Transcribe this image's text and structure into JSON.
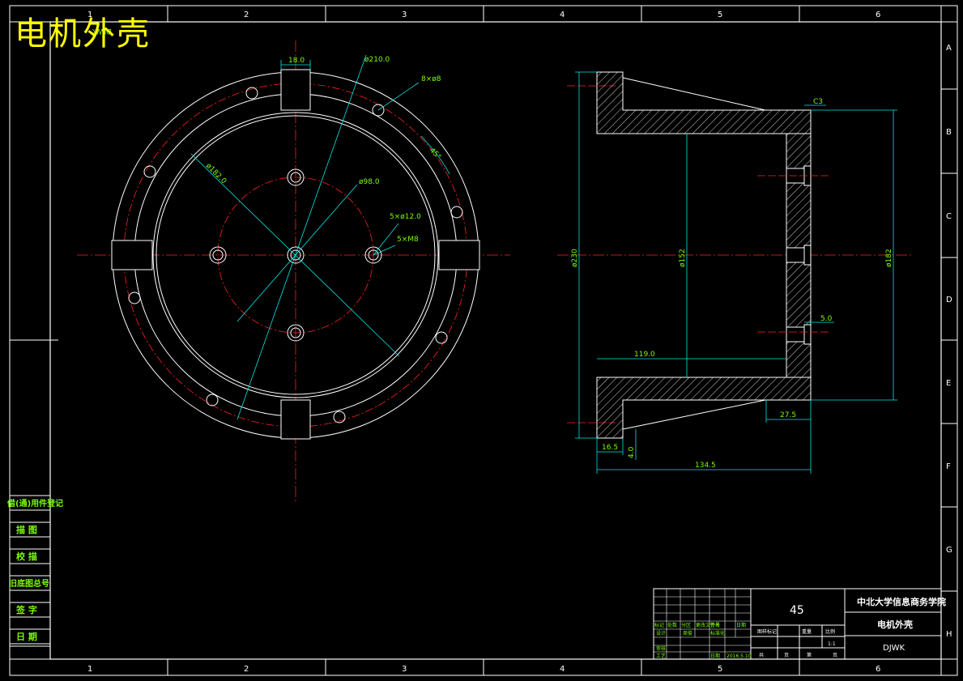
{
  "drawing": {
    "overlay_title": "电机外壳",
    "code_fragment": "DJWK",
    "grid_cols": [
      "1",
      "2",
      "3",
      "4",
      "5",
      "6"
    ],
    "grid_rows": [
      "A",
      "B",
      "C",
      "D",
      "E",
      "F",
      "G",
      "H"
    ]
  },
  "front_view": {
    "dims": {
      "slot_width": "18.0",
      "outer_dia": "ø210.0",
      "flange_holes": "8×ø8",
      "angle": "45°",
      "bore_dia": "ø182.0",
      "pcd_dia": "ø98.0",
      "inner_holes": "5×ø12.0",
      "thread": "5×M8"
    }
  },
  "side_view": {
    "dims": {
      "chamfer": "C3",
      "height_total": "ø230",
      "inner_dia": "ø152",
      "spigot_dia": "ø182",
      "depth": "119.0",
      "wall": "5.0",
      "step": "27.5",
      "flange_thk": "16.5",
      "lip": "4.0",
      "length": "134.5"
    }
  },
  "side_table": {
    "rows": [
      "借(通)用件登记",
      "描 图",
      "校 描",
      "旧底图总号",
      "签 字",
      "日 期"
    ]
  },
  "title_block": {
    "material": "45",
    "school": "中北大学信息商务学院",
    "part_name": "电机外壳",
    "code": "DJWK",
    "scale_label": "比例",
    "scale": "1:1",
    "weight_label": "重量",
    "stage_label": "图样标记",
    "sheet_total_label": "共",
    "sheet_label": "页",
    "page_label": "第",
    "date": "2016.5.10",
    "sign_labels": [
      "标记",
      "处数",
      "分区",
      "更改文件号",
      "签名",
      "日期"
    ],
    "role_labels": [
      "设计",
      "标准化",
      "审核",
      "工艺",
      "日期"
    ],
    "designer": "周俊"
  }
}
